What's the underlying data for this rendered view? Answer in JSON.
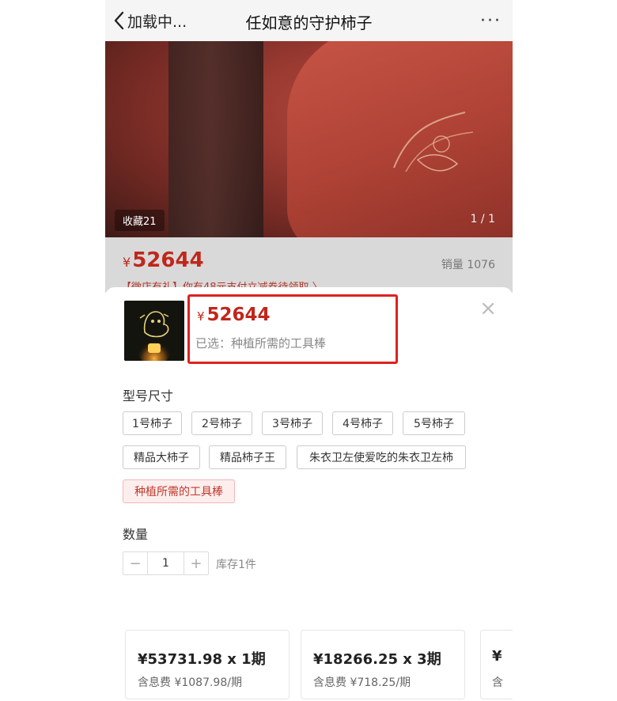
{
  "nav": {
    "back_label": "加载中...",
    "title": "任如意的守护柿子",
    "more": "···"
  },
  "hero": {
    "fav_label": "收藏21",
    "page_indicator": "1 / 1"
  },
  "product": {
    "currency": "¥",
    "price": "52644",
    "sales_label": "销量 1076",
    "promo_text": "【微店有礼】你有48元支付立减券待领取 〉"
  },
  "sheet": {
    "currency": "¥",
    "price": "52644",
    "selected_text": "已选：种植所需的工具棒",
    "close_icon": "×",
    "size_label": "型号尺寸",
    "options": [
      {
        "label": "1号柿子",
        "active": false
      },
      {
        "label": "2号柿子",
        "active": false
      },
      {
        "label": "3号柿子",
        "active": false
      },
      {
        "label": "4号柿子",
        "active": false
      },
      {
        "label": "5号柿子",
        "active": false
      },
      {
        "label": "精品大柿子",
        "active": false
      },
      {
        "label": "精品柿子王",
        "active": false
      },
      {
        "label": "朱衣卫左使爱吃的朱衣卫左柿",
        "active": false
      },
      {
        "label": "种植所需的工具棒",
        "active": true
      }
    ],
    "quantity_label": "数量",
    "quantity": {
      "minus": "−",
      "value": "1",
      "plus": "+"
    },
    "stock_text": "库存1件",
    "installments": [
      {
        "main": "¥53731.98 x 1期",
        "sub": "含息费 ¥1087.98/期"
      },
      {
        "main": "¥18266.25 x 3期",
        "sub": "含息费 ¥718.25/期"
      },
      {
        "main": "¥",
        "sub": "含"
      }
    ]
  },
  "colors": {
    "price_red": "#c0271c",
    "highlight_border": "#e02020",
    "active_option_bg": "#fdeeee"
  }
}
